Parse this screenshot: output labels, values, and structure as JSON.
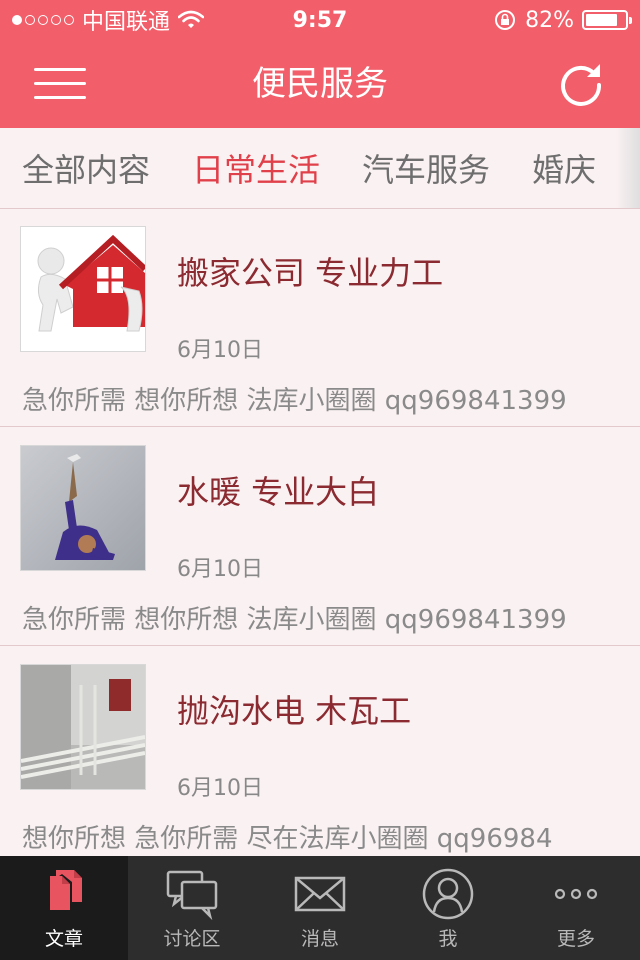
{
  "status_bar": {
    "carrier": "中国联通",
    "time": "9:57",
    "battery_text": "82%",
    "battery_level": 0.82,
    "signal_bars": 1
  },
  "nav": {
    "title": "便民服务",
    "menu_icon": "hamburger-icon",
    "refresh_icon": "refresh-icon"
  },
  "tabs": [
    {
      "label": "全部内容",
      "active": false
    },
    {
      "label": "日常生活",
      "active": true
    },
    {
      "label": "汽车服务",
      "active": false
    },
    {
      "label": "婚庆",
      "active": false
    }
  ],
  "articles": [
    {
      "title": "搬家公司 专业力工",
      "date": "6月10日",
      "desc": "急你所需 想你所想 法库小圈圈 qq969841399",
      "thumb": "moving-house-image"
    },
    {
      "title": "水暖 专业大白",
      "date": "6月10日",
      "desc": "急你所需 想你所想 法库小圈圈 qq969841399",
      "thumb": "ceiling-painting-image"
    },
    {
      "title": "抛沟水电 木瓦工",
      "date": "6月10日",
      "desc": "想你所想 急你所需  尽在法库小圈圈 qq96984",
      "thumb": "wall-wiring-image"
    }
  ],
  "tabbar": [
    {
      "label": "文章",
      "icon": "article-icon",
      "active": true
    },
    {
      "label": "讨论区",
      "icon": "chat-bubbles-icon",
      "active": false
    },
    {
      "label": "消息",
      "icon": "envelope-icon",
      "active": false
    },
    {
      "label": "我",
      "icon": "user-icon",
      "active": false
    },
    {
      "label": "更多",
      "icon": "more-dots-icon",
      "active": false
    }
  ],
  "colors": {
    "brand": "#f25f6a",
    "active_tab": "#e0404a",
    "title_text": "#8b2a30",
    "background": "#faf1f2",
    "tabbar": "#2e2d2e"
  }
}
